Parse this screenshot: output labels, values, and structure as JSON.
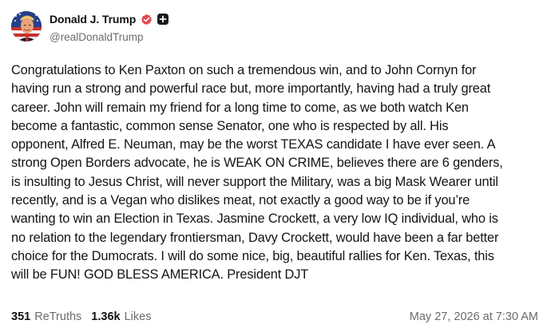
{
  "author": {
    "display_name": "Donald J. Trump",
    "handle": "@realDonaldTrump",
    "verified_icon": "verified-badge-icon",
    "extra_icon": "plus-icon",
    "avatar_icon": "profile-avatar",
    "verified_color": "#e5484d"
  },
  "post": {
    "text": "Congratulations to Ken Paxton on such a tremendous win, and to John Cornyn for\nhaving run a strong and powerful race but, more importantly, having had a truly great\ncareer. John will remain my friend for a long time to come, as we both watch Ken\nbecome a fantastic, common sense Senator, one who is respected by all. His\nopponent, Alfred E. Neuman, may be the worst TEXAS candidate I have ever seen. A\nstrong Open Borders advocate, he is WEAK ON CRIME, believes there are 6 genders,\nis insulting to Jesus Christ, will never support the Military, was a big Mask Wearer until\nrecently, and is a Vegan who dislikes meat, not exactly a good way to be if you’re\nwanting to win an Election in Texas. Jasmine Crockett, a very low IQ individual, who is\nno relation to the legendary frontiersman, Davy Crockett, would have been a far better\nchoice for the Dumocrats. I will do some nice, big, beautiful rallies for Ken. Texas, this\nwill be FUN! GOD BLESS AMERICA. President DJT"
  },
  "footer": {
    "retruths_count": "351",
    "retruths_label": "ReTruths",
    "likes_count": "1.36k",
    "likes_label": "Likes",
    "timestamp": "May 27, 2026 at 7:30 AM"
  }
}
